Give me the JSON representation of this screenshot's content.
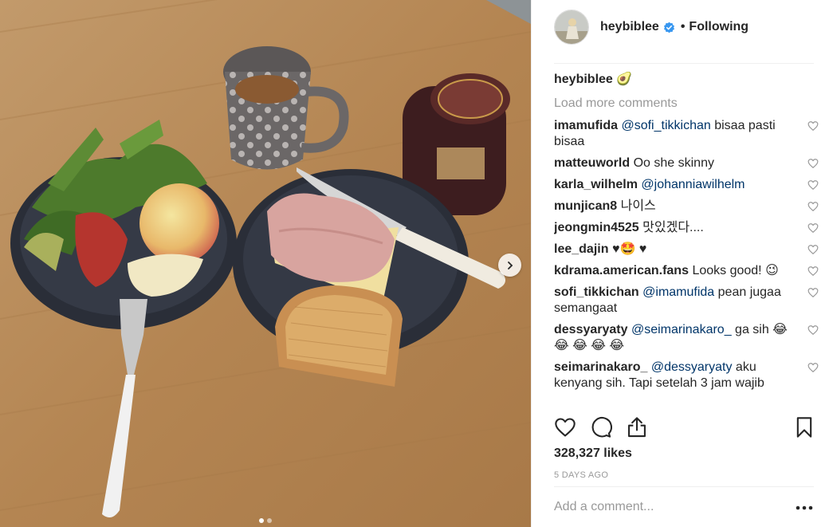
{
  "post": {
    "author": "heybiblee",
    "follow_label": "Following",
    "bullet": "•",
    "caption": {
      "username": "heybiblee",
      "text": "🥑"
    },
    "load_more": "Load more comments",
    "comments": [
      {
        "username": "imamufida",
        "mention": "@sofi_tikkichan",
        "text": " bisaa pasti bisaa"
      },
      {
        "username": "matteuworld",
        "mention": "",
        "text": " Oo she skinny"
      },
      {
        "username": "karla_wilhelm",
        "mention": "@johanniawilhelm",
        "text": ""
      },
      {
        "username": "munjican8",
        "mention": "",
        "text": " 나이스"
      },
      {
        "username": "jeongmin4525",
        "mention": "",
        "text": " 맛있겠다...."
      },
      {
        "username": "lee_dajin",
        "mention": "",
        "text": " ♥🤩 ♥"
      },
      {
        "username": "kdrama.american.fans",
        "mention": "",
        "text": " Looks good! 😉"
      },
      {
        "username": "sofi_tikkichan",
        "mention": "@imamufida",
        "text": " pean jugaa semangaat"
      },
      {
        "username": "dessyaryaty",
        "mention": "@seimarinakaro_",
        "text": " ga sih 😂 😂 😂 😂 😂"
      },
      {
        "username": "seimarinakaro_",
        "mention": "@dessyaryaty",
        "text": " aku kenyang sih. Tapi setelah 3 jam wajib"
      }
    ],
    "likes": "328,327 likes",
    "date": "5 DAYS AGO",
    "add_comment_placeholder": "Add a comment...",
    "carousel": {
      "count": 2,
      "active": 0
    },
    "icons": [
      "verified-badge-icon",
      "heart-icon",
      "comment-icon",
      "share-icon",
      "bookmark-icon",
      "more-options-icon",
      "chevron-right-icon"
    ],
    "colors": {
      "mention": "#003569",
      "muted": "#999999",
      "verified": "#3897f0",
      "text": "#262626"
    }
  }
}
